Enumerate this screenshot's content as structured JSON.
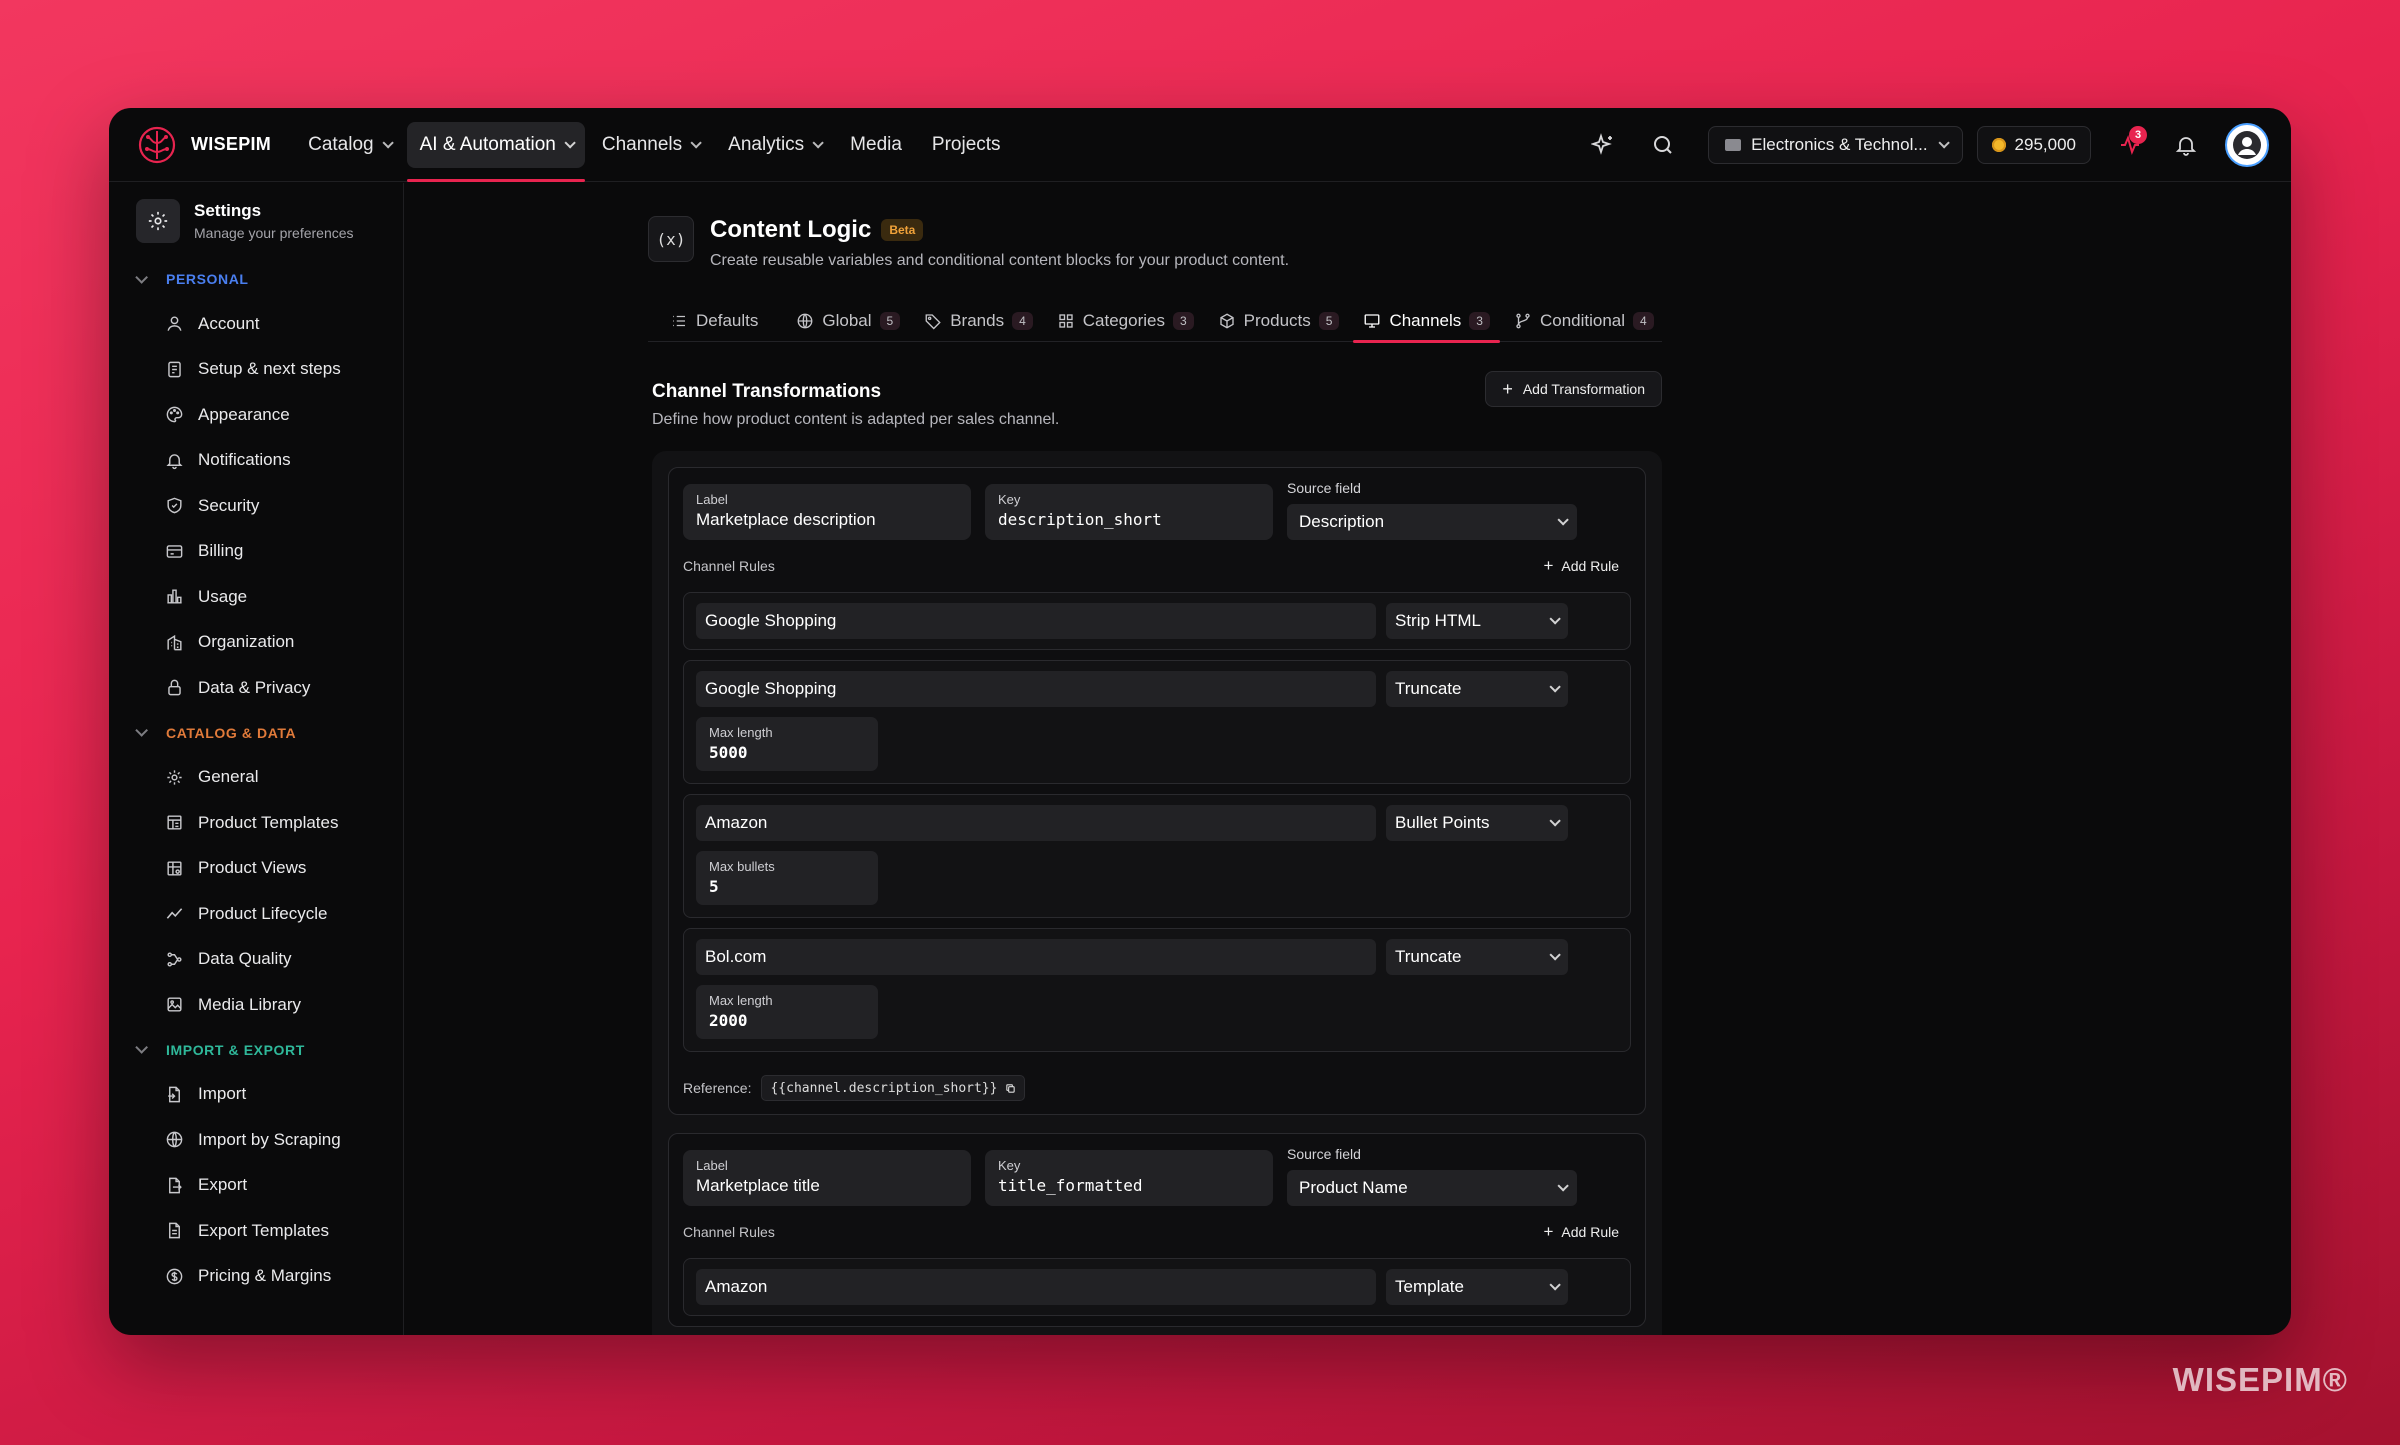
{
  "app": {
    "name": "WISEPIM",
    "watermark": "WISEPIM®"
  },
  "nav": {
    "items": [
      {
        "label": "Catalog",
        "dropdown": true
      },
      {
        "label": "AI & Automation",
        "dropdown": true,
        "active": true
      },
      {
        "label": "Channels",
        "dropdown": true
      },
      {
        "label": "Analytics",
        "dropdown": true
      },
      {
        "label": "Media",
        "dropdown": false
      },
      {
        "label": "Projects",
        "dropdown": false
      }
    ],
    "store": "Electronics & Technol...",
    "credits": "295,000",
    "notifications_badge": "3"
  },
  "sidebar": {
    "title": "Settings",
    "subtitle": "Manage your preferences",
    "sections": [
      {
        "label": "PERSONAL",
        "color": "#4a7ff0",
        "items": [
          {
            "label": "Account",
            "icon": "user-icon"
          },
          {
            "label": "Setup & next steps",
            "icon": "checklist-icon"
          },
          {
            "label": "Appearance",
            "icon": "palette-icon"
          },
          {
            "label": "Notifications",
            "icon": "bell-icon"
          },
          {
            "label": "Security",
            "icon": "shield-icon"
          },
          {
            "label": "Billing",
            "icon": "credit-card-icon"
          },
          {
            "label": "Usage",
            "icon": "bar-chart-icon"
          },
          {
            "label": "Organization",
            "icon": "building-icon"
          },
          {
            "label": "Data & Privacy",
            "icon": "lock-icon"
          }
        ]
      },
      {
        "label": "CATALOG & DATA",
        "color": "#e07a3a",
        "items": [
          {
            "label": "General",
            "icon": "gear-icon"
          },
          {
            "label": "Product Templates",
            "icon": "template-icon"
          },
          {
            "label": "Product Views",
            "icon": "table-icon"
          },
          {
            "label": "Product Lifecycle",
            "icon": "trend-icon"
          },
          {
            "label": "Data Quality",
            "icon": "workflow-icon"
          },
          {
            "label": "Media Library",
            "icon": "image-icon"
          }
        ]
      },
      {
        "label": "IMPORT & EXPORT",
        "color": "#2fb89a",
        "items": [
          {
            "label": "Import",
            "icon": "file-import-icon"
          },
          {
            "label": "Import by Scraping",
            "icon": "globe-icon"
          },
          {
            "label": "Export",
            "icon": "file-export-icon"
          },
          {
            "label": "Export Templates",
            "icon": "file-template-icon"
          },
          {
            "label": "Pricing & Margins",
            "icon": "dollar-icon"
          }
        ]
      }
    ]
  },
  "page": {
    "icon_text": "(x)",
    "title": "Content Logic",
    "badge": "Beta",
    "subtitle": "Create reusable variables and conditional content blocks for your product content.",
    "tabs": [
      {
        "label": "Defaults",
        "count": "",
        "icon": "list-icon"
      },
      {
        "label": "Global",
        "count": "5",
        "icon": "globe-icon"
      },
      {
        "label": "Brands",
        "count": "4",
        "icon": "tag-icon"
      },
      {
        "label": "Categories",
        "count": "3",
        "icon": "grid-icon"
      },
      {
        "label": "Products",
        "count": "5",
        "icon": "box-icon"
      },
      {
        "label": "Channels",
        "count": "3",
        "icon": "monitor-icon",
        "active": true
      },
      {
        "label": "Conditional",
        "count": "4",
        "icon": "branch-icon"
      }
    ]
  },
  "transformations": {
    "title": "Channel Transformations",
    "subtitle": "Define how product content is adapted per sales channel.",
    "add_label": "Add Transformation",
    "label_caption": "Label",
    "key_caption": "Key",
    "source_caption": "Source field",
    "rules_caption": "Channel Rules",
    "add_rule_label": "Add Rule",
    "reference_caption": "Reference:",
    "items": [
      {
        "label": "Marketplace description",
        "key": "description_short",
        "source": "Description",
        "reference": "{{channel.description_short}}",
        "rules": [
          {
            "channel": "Google Shopping",
            "type": "Strip HTML"
          },
          {
            "channel": "Google Shopping",
            "type": "Truncate",
            "param_label": "Max length",
            "param_value": "5000"
          },
          {
            "channel": "Amazon",
            "type": "Bullet Points",
            "param_label": "Max bullets",
            "param_value": "5"
          },
          {
            "channel": "Bol.com",
            "type": "Truncate",
            "param_label": "Max length",
            "param_value": "2000"
          }
        ]
      },
      {
        "label": "Marketplace title",
        "key": "title_formatted",
        "source": "Product Name",
        "rules": [
          {
            "channel": "Amazon",
            "type": "Template"
          }
        ]
      }
    ]
  }
}
